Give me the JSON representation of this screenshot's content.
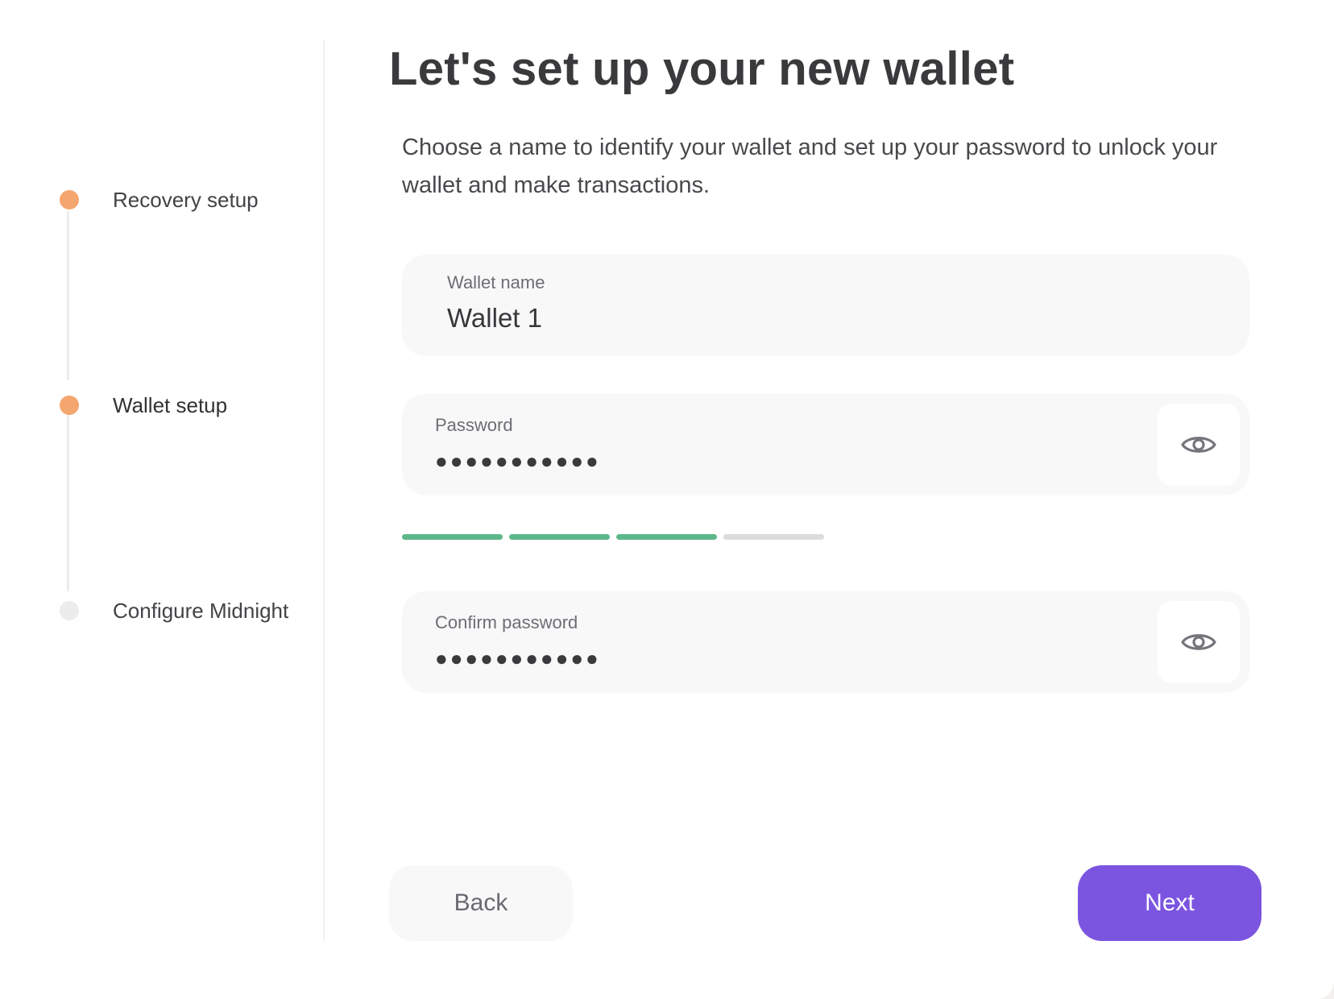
{
  "stepper": {
    "steps": [
      {
        "label": "Recovery setup",
        "state": "completed"
      },
      {
        "label": "Wallet setup",
        "state": "active"
      },
      {
        "label": "Configure Midnight",
        "state": "pending"
      }
    ]
  },
  "header": {
    "title": "Let's set up your new wallet",
    "subtitle": "Choose a name to identify your wallet and set up your password to unlock your wallet and make transactions."
  },
  "form": {
    "wallet_name": {
      "label": "Wallet name",
      "value": "Wallet 1"
    },
    "password": {
      "label": "Password",
      "masked_value": "●●●●●●●●●●●",
      "toggle_icon": "eye-icon"
    },
    "password_strength": {
      "level": 3,
      "max": 4
    },
    "confirm_password": {
      "label": "Confirm password",
      "masked_value": "●●●●●●●●●●●",
      "toggle_icon": "eye-icon"
    }
  },
  "actions": {
    "back_label": "Back",
    "next_label": "Next"
  },
  "colors": {
    "step_active": "#f4a66f",
    "step_pending": "#ececec",
    "strength_filled": "#5cb88a",
    "strength_empty": "#dcdcdc",
    "primary": "#7b55e0",
    "primary_text": "#ffffff"
  }
}
